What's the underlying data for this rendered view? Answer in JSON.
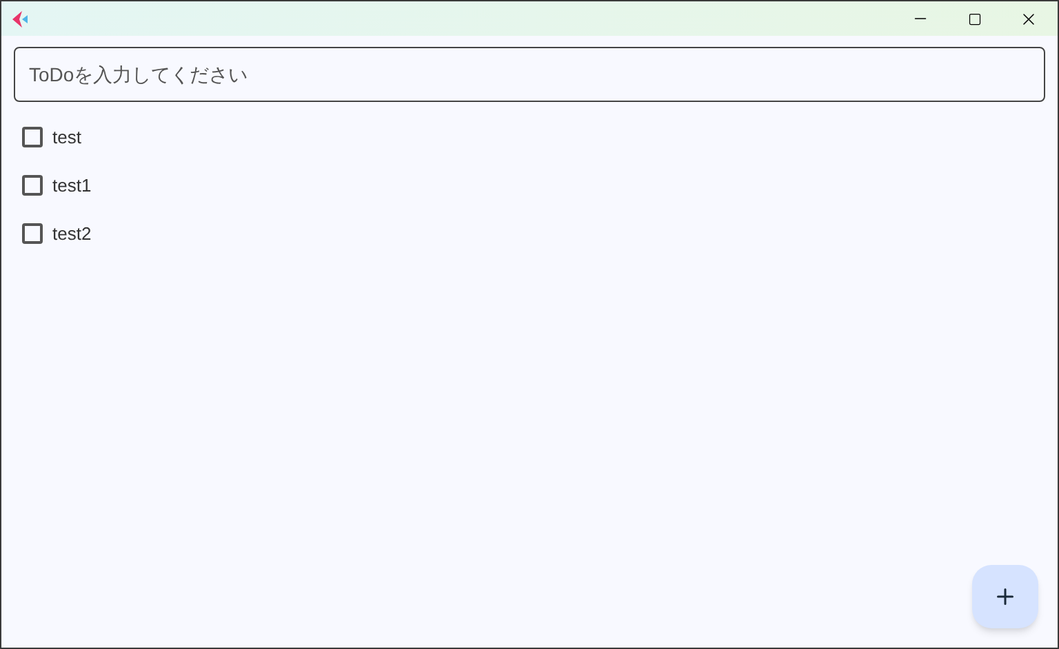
{
  "input": {
    "placeholder": "ToDoを入力してください"
  },
  "todos": [
    {
      "label": "test",
      "checked": false
    },
    {
      "label": "test1",
      "checked": false
    },
    {
      "label": "test2",
      "checked": false
    }
  ]
}
